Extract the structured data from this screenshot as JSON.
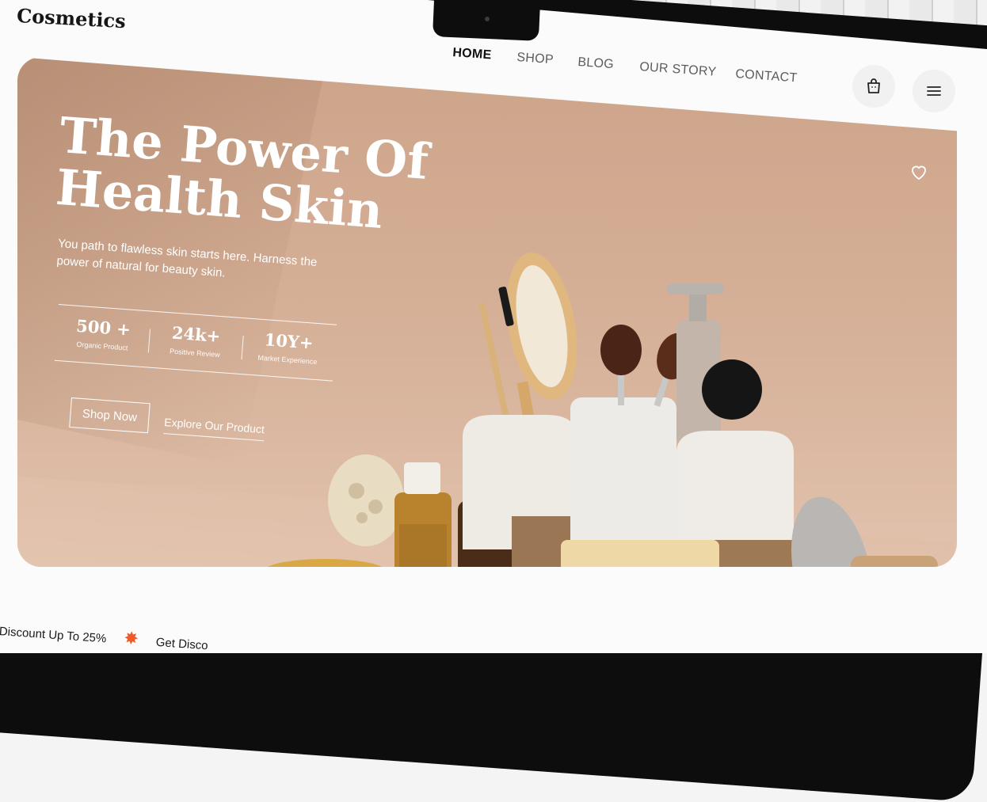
{
  "brand": "Cosmetics",
  "nav": {
    "items": [
      "HOME",
      "SHOP",
      "BLOG",
      "OUR STORY",
      "CONTACT"
    ],
    "active": "HOME"
  },
  "icons": {
    "cart": "shopping-bag-icon",
    "menu": "hamburger-menu-icon",
    "favorite": "heart-icon"
  },
  "hero": {
    "title_line1": "The Power Of",
    "title_line2": "Health Skin",
    "subtitle": "You path to flawless skin starts here. Harness the power of natural for beauty skin.",
    "stats": [
      {
        "value": "500 +",
        "label": "Organic Product"
      },
      {
        "value": "24k+",
        "label": "Positive Review"
      },
      {
        "value": "10Y+",
        "label": "Market Experience"
      }
    ],
    "cta_primary": "Shop Now",
    "cta_secondary": "Explore Our Product"
  },
  "marquee": {
    "item1": "Discount Up To 25%",
    "item2": "Get Disco"
  },
  "colors": {
    "hero_bg": "#d2ab91",
    "accent_star": "#f05a28",
    "text_dark": "#111111"
  }
}
